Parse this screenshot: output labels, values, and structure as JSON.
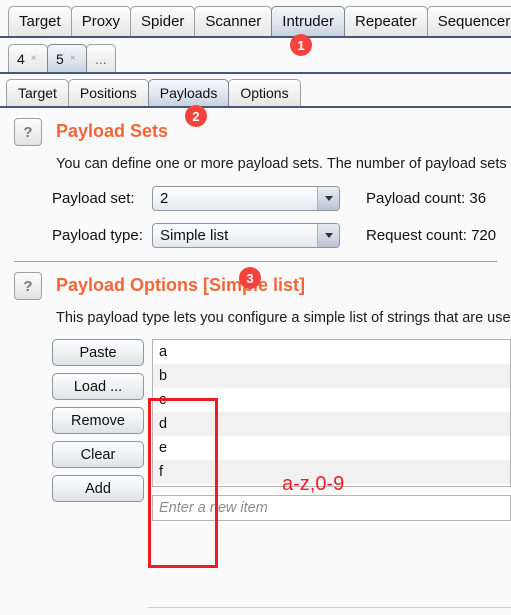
{
  "main_tabs": [
    {
      "label": "Target",
      "selected": false
    },
    {
      "label": "Proxy",
      "selected": false
    },
    {
      "label": "Spider",
      "selected": false
    },
    {
      "label": "Scanner",
      "selected": false
    },
    {
      "label": "Intruder",
      "selected": true
    },
    {
      "label": "Repeater",
      "selected": false
    },
    {
      "label": "Sequencer",
      "selected": false
    }
  ],
  "attack_tabs": [
    {
      "label": "4",
      "close": "×",
      "selected": false
    },
    {
      "label": "5",
      "close": "×",
      "selected": true
    },
    {
      "label": "...",
      "close": "",
      "selected": false
    }
  ],
  "sub_tabs": [
    {
      "label": "Target",
      "selected": false
    },
    {
      "label": "Positions",
      "selected": false
    },
    {
      "label": "Payloads",
      "selected": true
    },
    {
      "label": "Options",
      "selected": false
    }
  ],
  "payload_sets": {
    "help_icon": "question-mark-icon",
    "title": "Payload Sets",
    "description": "You can define one or more payload sets. The number of payload sets depends on the attack type defined in the Positions tab. Various payload types are available for each payload set, and each payload type can be customized in different ways.",
    "payload_set_label": "Payload set:",
    "payload_set_value": "2",
    "payload_type_label": "Payload type:",
    "payload_type_value": "Simple list",
    "payload_count_label": "Payload count:",
    "payload_count_value": "36",
    "request_count_label": "Request count:",
    "request_count_value": "720"
  },
  "payload_options": {
    "help_icon": "question-mark-icon",
    "title": "Payload Options [Simple list]",
    "description": "This payload type lets you configure a simple list of strings that are used as payloads.",
    "buttons": [
      {
        "label": "Paste"
      },
      {
        "label": "Load ..."
      },
      {
        "label": "Remove"
      },
      {
        "label": "Clear"
      },
      {
        "label": "Add"
      }
    ],
    "list_items": [
      "a",
      "b",
      "c",
      "d",
      "e",
      "f"
    ],
    "new_item_placeholder": "Enter a new item",
    "new_item_value": ""
  },
  "annotations": {
    "badge1": "1",
    "badge2": "2",
    "badge3": "3",
    "range_label": "a-z,0-9"
  },
  "colors": {
    "heading_orange": "#f4663a",
    "annotation_red": "#ee1c24",
    "badge_red": "#f4423c",
    "tab_selected": "#c7d2e0",
    "tab_border_bottom": "#4a5878"
  }
}
